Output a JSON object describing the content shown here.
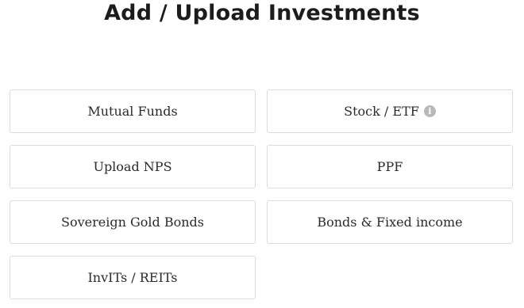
{
  "page": {
    "title": "Add / Upload Investments"
  },
  "options": [
    {
      "label": "Mutual Funds"
    },
    {
      "label": "Stock / ETF",
      "has_info_icon": true,
      "info_glyph": "i"
    },
    {
      "label": "Upload NPS"
    },
    {
      "label": "PPF"
    },
    {
      "label": "Sovereign Gold Bonds"
    },
    {
      "label": "Bonds & Fixed income"
    },
    {
      "label": "InvITs / REITs"
    }
  ],
  "icons": {
    "info": "info-icon"
  },
  "colors": {
    "title_text": "#1c1c1c",
    "option_border": "#dcdcdc",
    "option_text": "#2a2a2a",
    "info_icon_bg": "#b8b8b8"
  }
}
